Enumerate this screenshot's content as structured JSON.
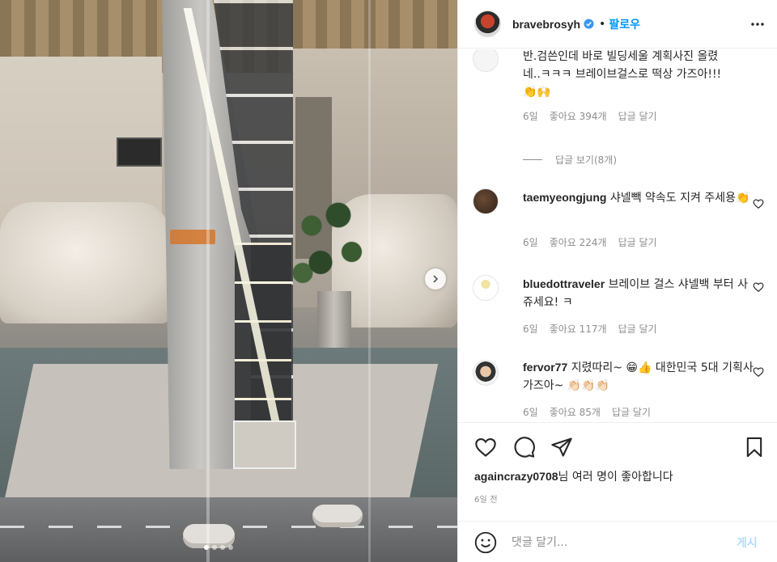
{
  "post": {
    "author": "bravebrosyh",
    "separator": "•",
    "follow_label": "팔로우",
    "image_dots": 4,
    "active_dot": 0
  },
  "comments": {
    "partial": {
      "text_line1": "반.검쓴인데 바로 빌딩세울 계획사진 올렸",
      "text_line2": "네..ㅋㅋㅋ 브레이브걸스로 떡상 가즈아!!!",
      "emoji": "👏🙌",
      "time": "6일",
      "likes": "좋아요 394개",
      "reply": "답글 달기"
    },
    "view_replies": "답글 보기(8개)",
    "items": [
      {
        "user": "taemyeongjung",
        "text": "샤넬빽 약속도 지켜 주세용👏",
        "time": "6일",
        "likes": "좋아요 224개",
        "reply": "답글 달기"
      },
      {
        "user": "bluedottraveler",
        "text": "브레이브 걸스 샤넬백 부터 사쥬세요! ㅋ",
        "time": "6일",
        "likes": "좋아요 117개",
        "reply": "답글 달기"
      },
      {
        "user": "fervor77",
        "text": "지렸따리~ 😁👍 대한민국 5대 기획사 가즈아~ 👏🏻👏🏻👏🏻",
        "time": "6일",
        "likes": "좋아요 85개",
        "reply": "답글 달기"
      }
    ]
  },
  "likes_summary": {
    "user": "againcrazy0708",
    "suffix": "님 여러 명이 좋아합니다"
  },
  "post_time": "6일 전",
  "comment_box": {
    "placeholder": "댓글 달기...",
    "post_label": "게시"
  },
  "colors": {
    "link_blue": "#0095f6",
    "post_disabled": "#b3dbff",
    "meta_gray": "#8e8e8e"
  }
}
